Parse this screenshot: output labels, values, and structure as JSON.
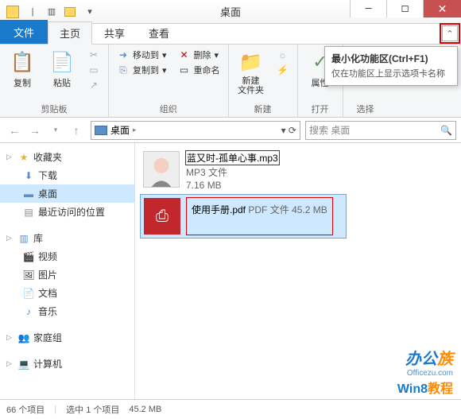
{
  "titlebar": {
    "title": "桌面"
  },
  "tabs": {
    "file": "文件",
    "home": "主页",
    "share": "共享",
    "view": "查看"
  },
  "tooltip": {
    "title": "最小化功能区(Ctrl+F1)",
    "body": "仅在功能区上显示选项卡名称"
  },
  "ribbon": {
    "clipboard": {
      "label": "剪贴板",
      "copy": "复制",
      "paste": "粘贴"
    },
    "organize": {
      "label": "组织",
      "moveto": "移动到",
      "copyto": "复制到",
      "delete": "删除",
      "rename": "重命名"
    },
    "new": {
      "label": "新建",
      "newfolder": "新建\n文件夹"
    },
    "open": {
      "label": "打开",
      "props": "属性"
    },
    "select": {
      "label": "选择"
    }
  },
  "nav": {
    "location": "桌面",
    "search_placeholder": "搜索 桌面"
  },
  "sidebar": {
    "favorites": "收藏夹",
    "downloads": "下载",
    "desktop": "桌面",
    "recent": "最近访问的位置",
    "libraries": "库",
    "videos": "视频",
    "pictures": "图片",
    "documents": "文档",
    "music": "音乐",
    "homegroup": "家庭组",
    "computer": "计算机"
  },
  "files": [
    {
      "name": "蓝又时-孤单心事.mp3",
      "type": "MP3 文件",
      "size": "7.16 MB"
    },
    {
      "name": "使用手册.pdf",
      "type": "PDF 文件",
      "size": "45.2 MB"
    }
  ],
  "status": {
    "count": "66 个项目",
    "selected": "选中 1 个项目",
    "size": "45.2 MB"
  },
  "watermark": {
    "brand_a": "办公",
    "brand_b": "族",
    "url": "Officezu.com",
    "tut_a": "Win8",
    "tut_b": "教程"
  }
}
